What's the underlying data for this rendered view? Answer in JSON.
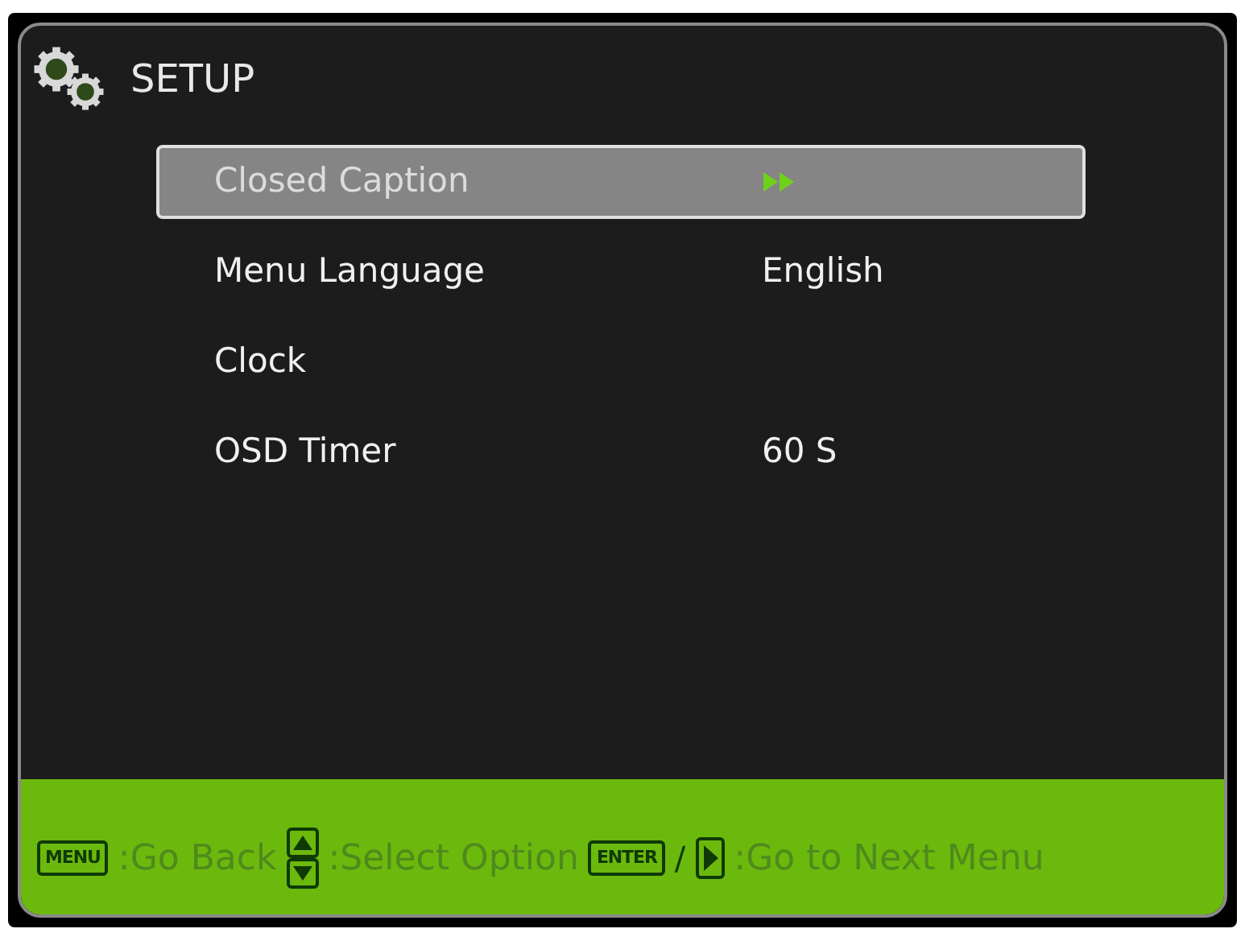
{
  "title": "SETUP",
  "items": [
    {
      "label": "Closed Caption",
      "selected": true,
      "arrow": true
    },
    {
      "label": "Menu Language",
      "selected": false,
      "arrow": false,
      "value": "English"
    },
    {
      "label": "Clock",
      "selected": false,
      "arrow": false
    },
    {
      "label": "OSD Timer",
      "selected": false,
      "arrow": false,
      "value": "60 S"
    }
  ],
  "footer": [
    {
      "kind": "key",
      "text": "MENU"
    },
    {
      "kind": "text",
      "text": ":Go Back"
    },
    {
      "kind": "updown"
    },
    {
      "kind": "text",
      "text": ":Select Option"
    },
    {
      "kind": "key",
      "text": "ENTER"
    },
    {
      "kind": "sep",
      "text": "/"
    },
    {
      "kind": "right"
    },
    {
      "kind": "text",
      "text": ":Go to Next Menu"
    }
  ]
}
